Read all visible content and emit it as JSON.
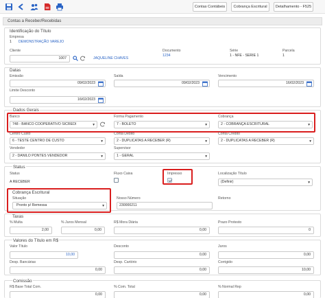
{
  "toolbar": {
    "icons": [
      "save-icon",
      "back-arrow-icon",
      "users-icon",
      "pdf-icon",
      "print-icon"
    ],
    "buttons": {
      "contas_contabeis": "Contas Contábeis",
      "cobranca_escritural": "Cobrança Escritural",
      "detalhamento": "Detalhamento - F525"
    }
  },
  "page_title": "Contas a Receber/Recebidas",
  "identificacao": {
    "title": "Identificação do Título",
    "empresa_label": "Empresa",
    "empresa_codigo": "1",
    "empresa_nome": "DEMONSTRAÇÃO VAREJO",
    "cliente_label": "Cliente",
    "cliente_codigo": "1007",
    "cliente_nome": "JAQUELINE CHAVES",
    "documento_label": "Documento",
    "documento_valor": "1234",
    "serie_label": "Série",
    "serie_valor": "1 - NFE - SERIE 1",
    "parcela_label": "Parcela",
    "parcela_valor": "1"
  },
  "datas": {
    "title": "Datas",
    "emissao_label": "Emissão",
    "emissao_valor": "09/02/2023",
    "saida_label": "Saída",
    "saida_valor": "09/02/2023",
    "vencimento_label": "Vencimento",
    "vencimento_valor": "16/02/2023",
    "limite_label": "Limite Desconto",
    "limite_valor": "16/02/2023"
  },
  "dados_gerais": {
    "title": "Dados Gerais",
    "banco_label": "Banco",
    "banco_valor": "748 - BANCO COOPERATIVO SICREDI",
    "forma_label": "Forma Pagamento",
    "forma_valor": "7 - BOLETO",
    "cobranca_label": "Cobrança",
    "cobranca_valor": "2 - COBRANÇA ESCRITURAL",
    "centro_label": "Centro Custo",
    "centro_valor": "6 - TESTE CENTRO DE CUSTO",
    "conta_debito_label": "Conta Débito",
    "conta_debito_valor": "2 - DUPLICATAS A RECEBER (R)",
    "conta_credito_label": "Conta Crédito",
    "conta_credito_valor": "2 - DUPLICATAS A RECEBER (R)",
    "vendedor_label": "Vendedor",
    "vendedor_valor": "2 - DANILO PONTES VENDEDOR",
    "supervisor_label": "Supervisor",
    "supervisor_valor": "1 - GERAL"
  },
  "status": {
    "title": "Status",
    "status_label": "Status",
    "status_valor": "A RECEBER",
    "fluxo_label": "Fluxo Caixa",
    "fluxo_checked": false,
    "impresso_label": "Impresso",
    "impresso_checked": true,
    "localizacao_label": "Localização Título",
    "localizacao_valor": "(Definir)"
  },
  "cobranca_escritural": {
    "title": "Cobrança Escritural",
    "situacao_label": "Situação",
    "situacao_valor": "Pronto p/ Remessa",
    "nosso_numero_label": "Nosso Número",
    "nosso_numero_valor": "230000211",
    "retorno_label": "Retorno"
  },
  "taxas": {
    "title": "Taxas",
    "multa_label": "% Multa",
    "multa_valor": "2,00",
    "juros_label": "% Juros Mensal",
    "juros_valor": "0,00",
    "mora_label": "R$ Mora Diária",
    "mora_valor": "0,00",
    "prazo_label": "Prazo Protesto",
    "prazo_valor": "0"
  },
  "valores": {
    "title": "Valores do Título em R$",
    "valor_titulo_label": "Valor Título",
    "valor_titulo_valor": "10,00",
    "desconto_label": "Desconto",
    "desconto_valor": "0,00",
    "juros_label": "Juros",
    "juros_valor": "0,00",
    "despesas_bancarias_label": "Desp. Bancárias",
    "despesas_bancarias_valor": "0,00",
    "despesas_cartorio_label": "Desp. Cartório",
    "despesas_cartorio_valor": "0,00",
    "corrigido_label": "Corrigido",
    "corrigido_valor": "10,00"
  },
  "comissao": {
    "title": "Comissão",
    "base_total_label": "R$ Base Total Com.",
    "base_total_valor": "0,00",
    "com_total_label": "% Com. Total",
    "com_total_valor": "0,00",
    "normal_rep_label": "% Normal Rep",
    "normal_rep_valor": "0,00"
  },
  "colors": {
    "highlight": "#d91d1d",
    "link": "#2a64c5",
    "icon_blue": "#2a64c5",
    "pdf_red": "#d62b2b"
  }
}
